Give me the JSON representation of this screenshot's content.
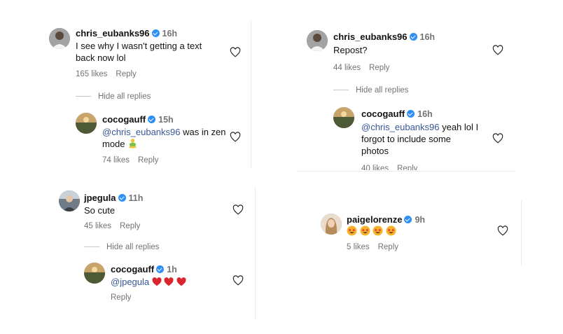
{
  "panel1": {
    "comment": {
      "username": "chris_eubanks96",
      "time": "16h",
      "text_line1": "I see why I wasn't getting a text",
      "text_line2": "back now lol",
      "likes": "165 likes",
      "reply": "Reply"
    },
    "hide_replies": "Hide all replies",
    "reply_comment": {
      "username": "cocogauff",
      "time": "15h",
      "mention": "@chris_eubanks96",
      "text_after_mention": " was in zen",
      "text_line2": "mode",
      "likes": "74 likes",
      "reply": "Reply"
    }
  },
  "panel2": {
    "comment": {
      "username": "chris_eubanks96",
      "time": "16h",
      "text": "Repost?",
      "likes": "44 likes",
      "reply": "Reply"
    },
    "hide_replies": "Hide all replies",
    "reply_comment": {
      "username": "cocogauff",
      "time": "16h",
      "mention": "@chris_eubanks96",
      "text_after_mention": " yeah lol I",
      "text_line2": "forgot to include some",
      "text_line3": "photos",
      "likes": "40 likes",
      "reply": "Reply"
    }
  },
  "panel3": {
    "comment": {
      "username": "jpegula",
      "time": "11h",
      "text": "So cute",
      "likes": "45 likes",
      "reply": "Reply"
    },
    "hide_replies": "Hide all replies",
    "reply_comment": {
      "username": "cocogauff",
      "time": "1h",
      "mention": "@jpegula",
      "reply": "Reply"
    }
  },
  "panel4": {
    "comment": {
      "username": "paigelorenze",
      "time": "9h",
      "likes": "5 likes",
      "reply": "Reply"
    }
  },
  "colors": {
    "verified": "#2e8ff5",
    "mention": "#375796",
    "meta": "#737373",
    "heart_red": "#d8262f"
  },
  "icons": {
    "like": "heart-outline-icon",
    "verified": "verified-badge-icon",
    "zen_emoji": "person-in-lotus-position-emoji",
    "heart_emoji": "red-heart-emoji",
    "star_struck_emoji": "star-struck-emoji"
  }
}
